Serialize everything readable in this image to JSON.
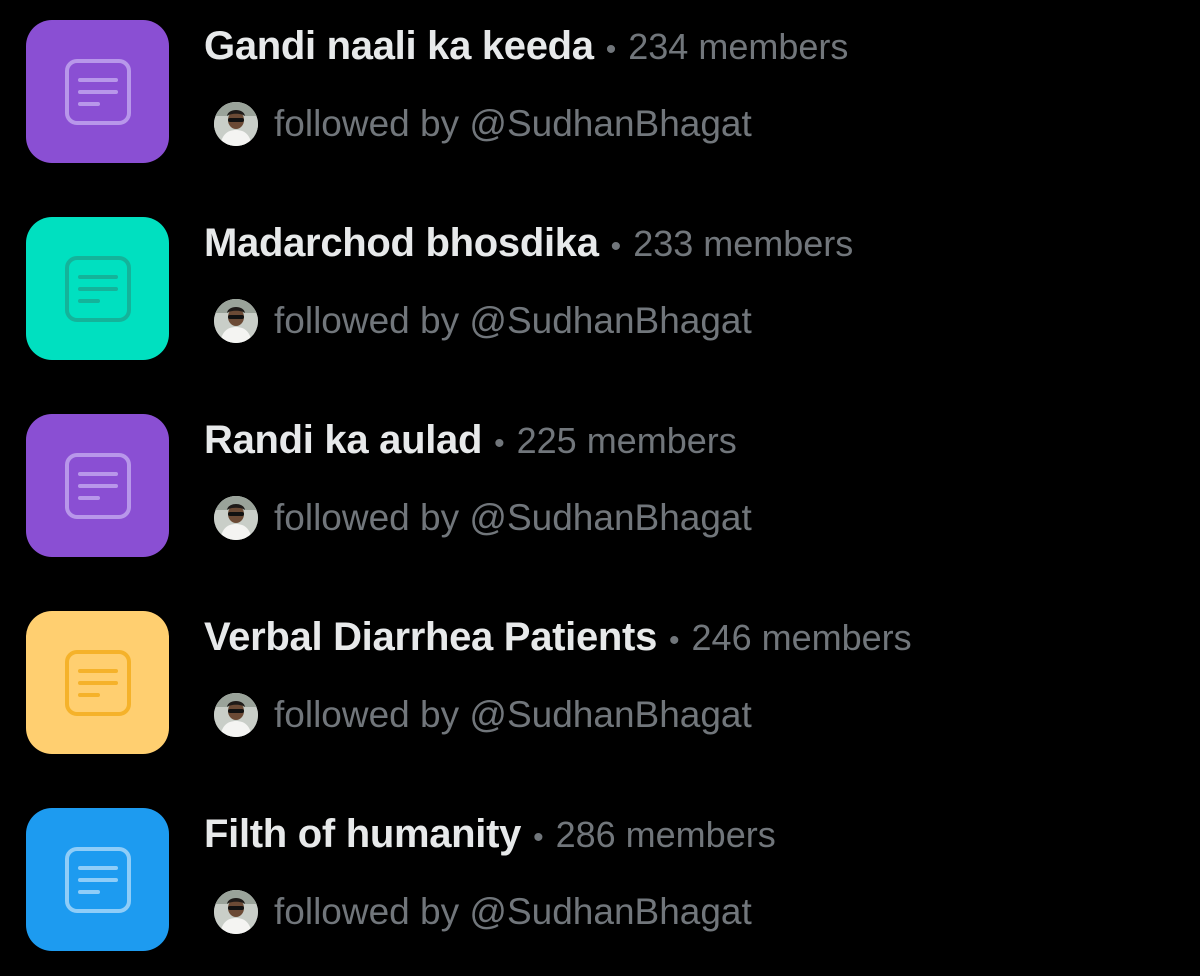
{
  "lists": [
    {
      "name": "Gandi naali ka keeda",
      "members": "234 members",
      "followed_by": "followed by @SudhanBhagat",
      "tile_color": "#8a4fd3",
      "icon_color": "#b897ea"
    },
    {
      "name": "Madarchod bhosdika",
      "members": "233 members",
      "followed_by": "followed by @SudhanBhagat",
      "tile_color": "#00e0c0",
      "icon_color": "#14b39a"
    },
    {
      "name": "Randi ka aulad",
      "members": "225 members",
      "followed_by": "followed by @SudhanBhagat",
      "tile_color": "#8a4fd3",
      "icon_color": "#b897ea"
    },
    {
      "name": "Verbal Diarrhea Patients",
      "members": "246 members",
      "followed_by": "followed by @SudhanBhagat",
      "tile_color": "#ffcf70",
      "icon_color": "#f5b22a"
    },
    {
      "name": "Filth of humanity",
      "members": "286 members",
      "followed_by": "followed by @SudhanBhagat",
      "tile_color": "#1d9bf0",
      "icon_color": "#8fcdf8"
    }
  ],
  "separator": "•",
  "list_icon": "list-icon",
  "avatar_icon": "avatar-icon"
}
